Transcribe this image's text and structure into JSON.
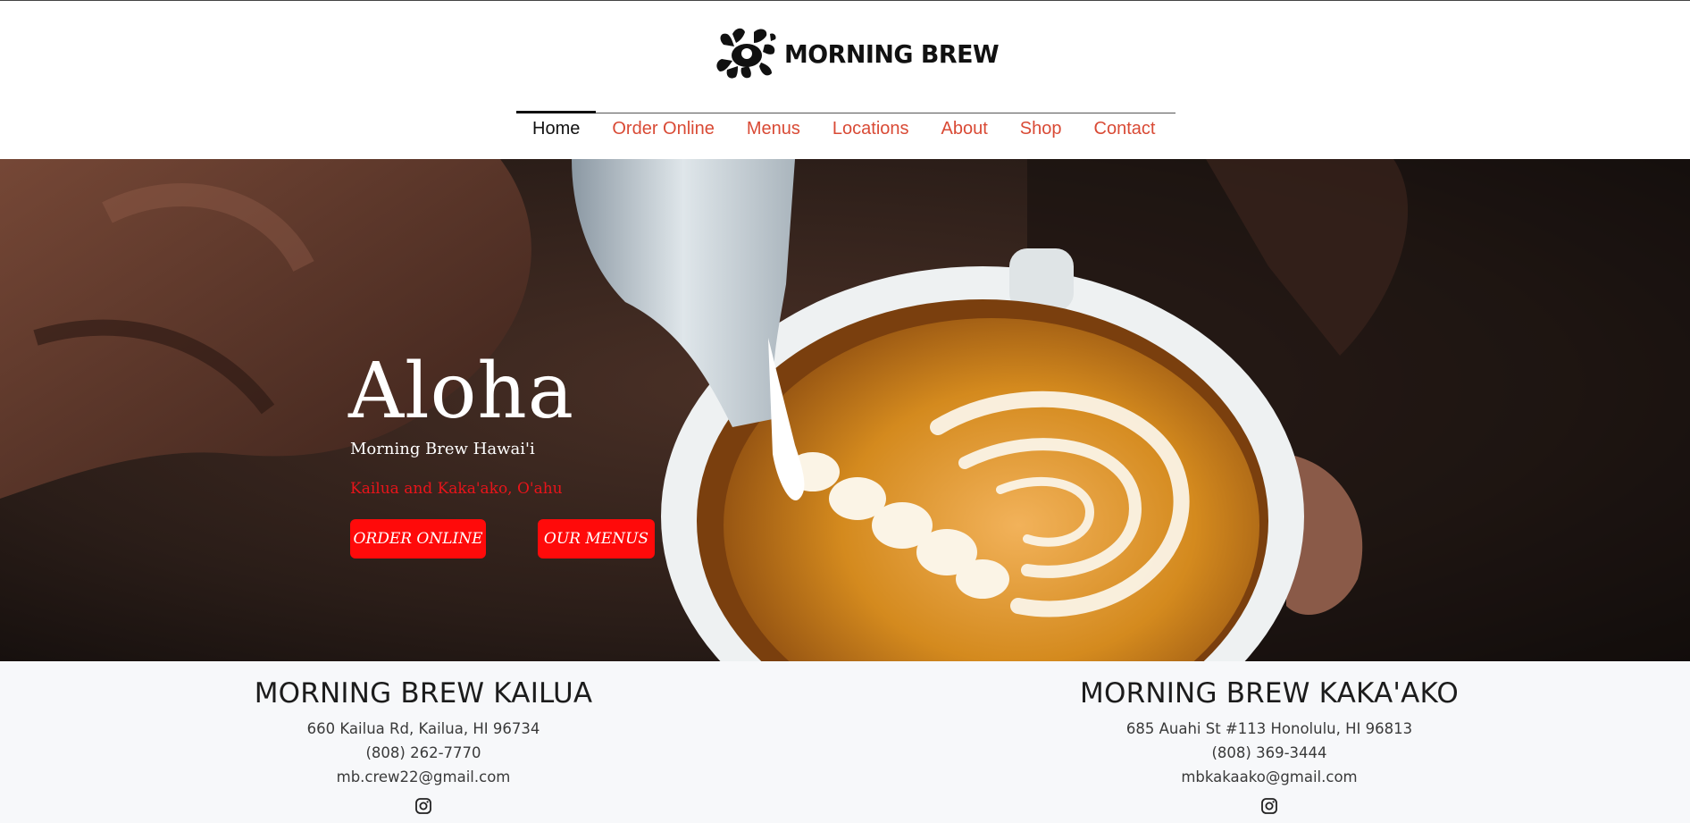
{
  "header": {
    "brand_name": "MORNING BREW",
    "nav": [
      {
        "label": "Home",
        "active": true
      },
      {
        "label": "Order Online",
        "active": false
      },
      {
        "label": "Menus",
        "active": false
      },
      {
        "label": "Locations",
        "active": false
      },
      {
        "label": "About",
        "active": false
      },
      {
        "label": "Shop",
        "active": false
      },
      {
        "label": "Contact",
        "active": false
      }
    ]
  },
  "hero": {
    "title": "Aloha",
    "subtitle": "Morning Brew Hawai'i",
    "location": "Kailua and Kaka'ako, O'ahu",
    "primary_cta": "ORDER ONLINE",
    "secondary_cta": "OUR MENUS"
  },
  "locations": [
    {
      "name": "MORNING BREW KAILUA",
      "address": "660 Kailua Rd, Kailua, HI 96734",
      "phone": "(808) 262-7770",
      "email": "mb.crew22@gmail.com",
      "social_icon": "instagram-icon"
    },
    {
      "name": "MORNING BREW KAKA'AKO",
      "address": "685 Auahi St #113 Honolulu, HI 96813",
      "phone": "(808) 369-3444",
      "email": "mbkakaako@gmail.com",
      "social_icon": "instagram-icon"
    }
  ],
  "colors": {
    "accent": "#d94a35",
    "cta": "#ff0a0a",
    "hero_location": "#e8141a",
    "footer_bg": "#f7f8fa"
  }
}
